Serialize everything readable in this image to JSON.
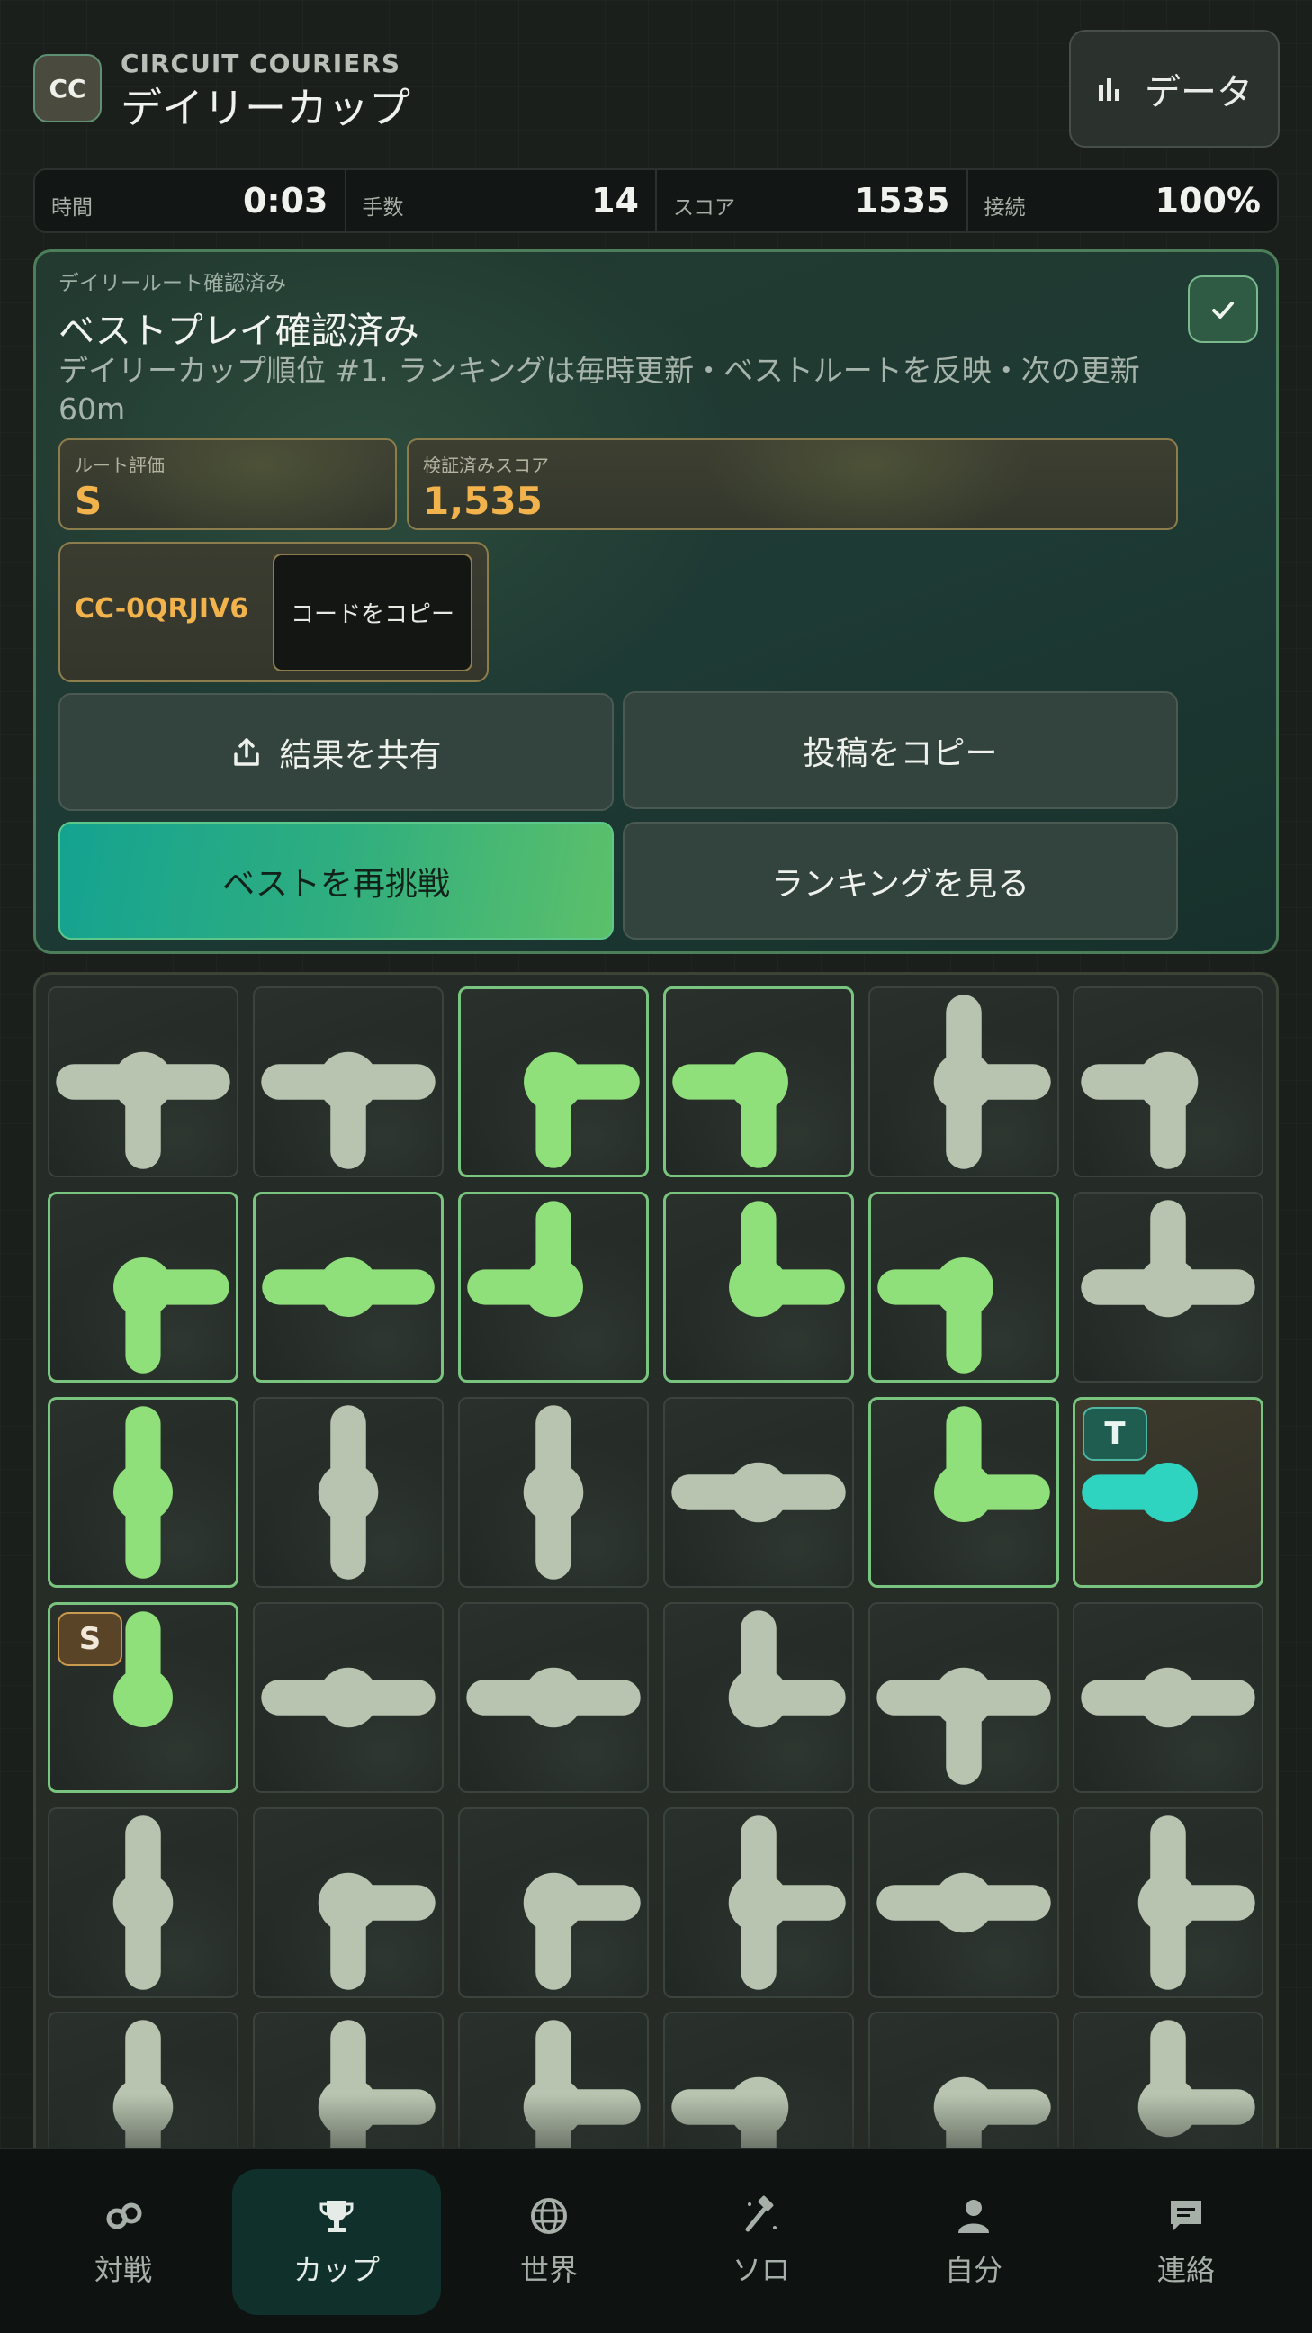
{
  "header": {
    "logo_text": "CC",
    "brand": "CIRCUIT COURIERS",
    "title": "デイリーカップ",
    "data_button": "データ"
  },
  "stats": {
    "time_label": "時間",
    "time_value": "0:03",
    "moves_label": "手数",
    "moves_value": "14",
    "score_label": "スコア",
    "score_value": "1535",
    "connect_label": "接続",
    "connect_value": "100%"
  },
  "result": {
    "kicker": "デイリールート確認済み",
    "title": "ベストプレイ確認済み",
    "description": "デイリーカップ順位 #1. ランキングは毎時更新・ベストルートを反映・次の更新 60m",
    "grade_label": "ルート評価",
    "grade_value": "S",
    "score_label": "検証済みスコア",
    "score_value": "1,535",
    "code": "CC-0QRJIV6",
    "copy_code": "コードをコピー",
    "share": "結果を共有",
    "copy_post": "投稿をコピー",
    "retry": "ベストを再挑戦",
    "ranking": "ランキングを見る"
  },
  "colors": {
    "lit_pipe": "#8fe07a",
    "unlit_pipe": "#b9c4b0",
    "target_pipe": "#2fd4c0",
    "accent": "#f2b34d"
  },
  "board": {
    "columns": 6,
    "source_label": "S",
    "target_label": "T",
    "tiles": [
      {
        "c": "ews",
        "lit": false
      },
      {
        "c": "ews",
        "lit": false
      },
      {
        "c": "es",
        "lit": true
      },
      {
        "c": "ws",
        "lit": true
      },
      {
        "c": "nse",
        "lit": false
      },
      {
        "c": "ws",
        "lit": false
      },
      {
        "c": "es",
        "lit": true
      },
      {
        "c": "ew",
        "lit": true
      },
      {
        "c": "nw",
        "lit": true
      },
      {
        "c": "ne",
        "lit": true
      },
      {
        "c": "ws",
        "lit": true
      },
      {
        "c": "new",
        "lit": false
      },
      {
        "c": "ns",
        "lit": true
      },
      {
        "c": "ns",
        "lit": false
      },
      {
        "c": "ns",
        "lit": false
      },
      {
        "c": "ew",
        "lit": false
      },
      {
        "c": "ne",
        "lit": true
      },
      {
        "c": "w",
        "lit": true,
        "target": true
      },
      {
        "c": "n",
        "lit": true,
        "source": true
      },
      {
        "c": "ew",
        "lit": false
      },
      {
        "c": "ew",
        "lit": false
      },
      {
        "c": "ne",
        "lit": false
      },
      {
        "c": "ews",
        "lit": false
      },
      {
        "c": "ew",
        "lit": false
      },
      {
        "c": "ns",
        "lit": false
      },
      {
        "c": "es",
        "lit": false
      },
      {
        "c": "es",
        "lit": false
      },
      {
        "c": "nse",
        "lit": false
      },
      {
        "c": "ew",
        "lit": false
      },
      {
        "c": "nse",
        "lit": false
      },
      {
        "c": "ns",
        "lit": false
      },
      {
        "c": "nse",
        "lit": false
      },
      {
        "c": "nse",
        "lit": false
      },
      {
        "c": "ws",
        "lit": false
      },
      {
        "c": "es",
        "lit": false
      },
      {
        "c": "ne",
        "lit": false
      }
    ]
  },
  "nav": [
    {
      "label": "対戦",
      "icon": "versus-icon",
      "active": false
    },
    {
      "label": "カップ",
      "icon": "trophy-icon",
      "active": true
    },
    {
      "label": "世界",
      "icon": "globe-icon",
      "active": false
    },
    {
      "label": "ソロ",
      "icon": "hammer-icon",
      "active": false
    },
    {
      "label": "自分",
      "icon": "person-icon",
      "active": false
    },
    {
      "label": "連絡",
      "icon": "message-icon",
      "active": false
    }
  ]
}
